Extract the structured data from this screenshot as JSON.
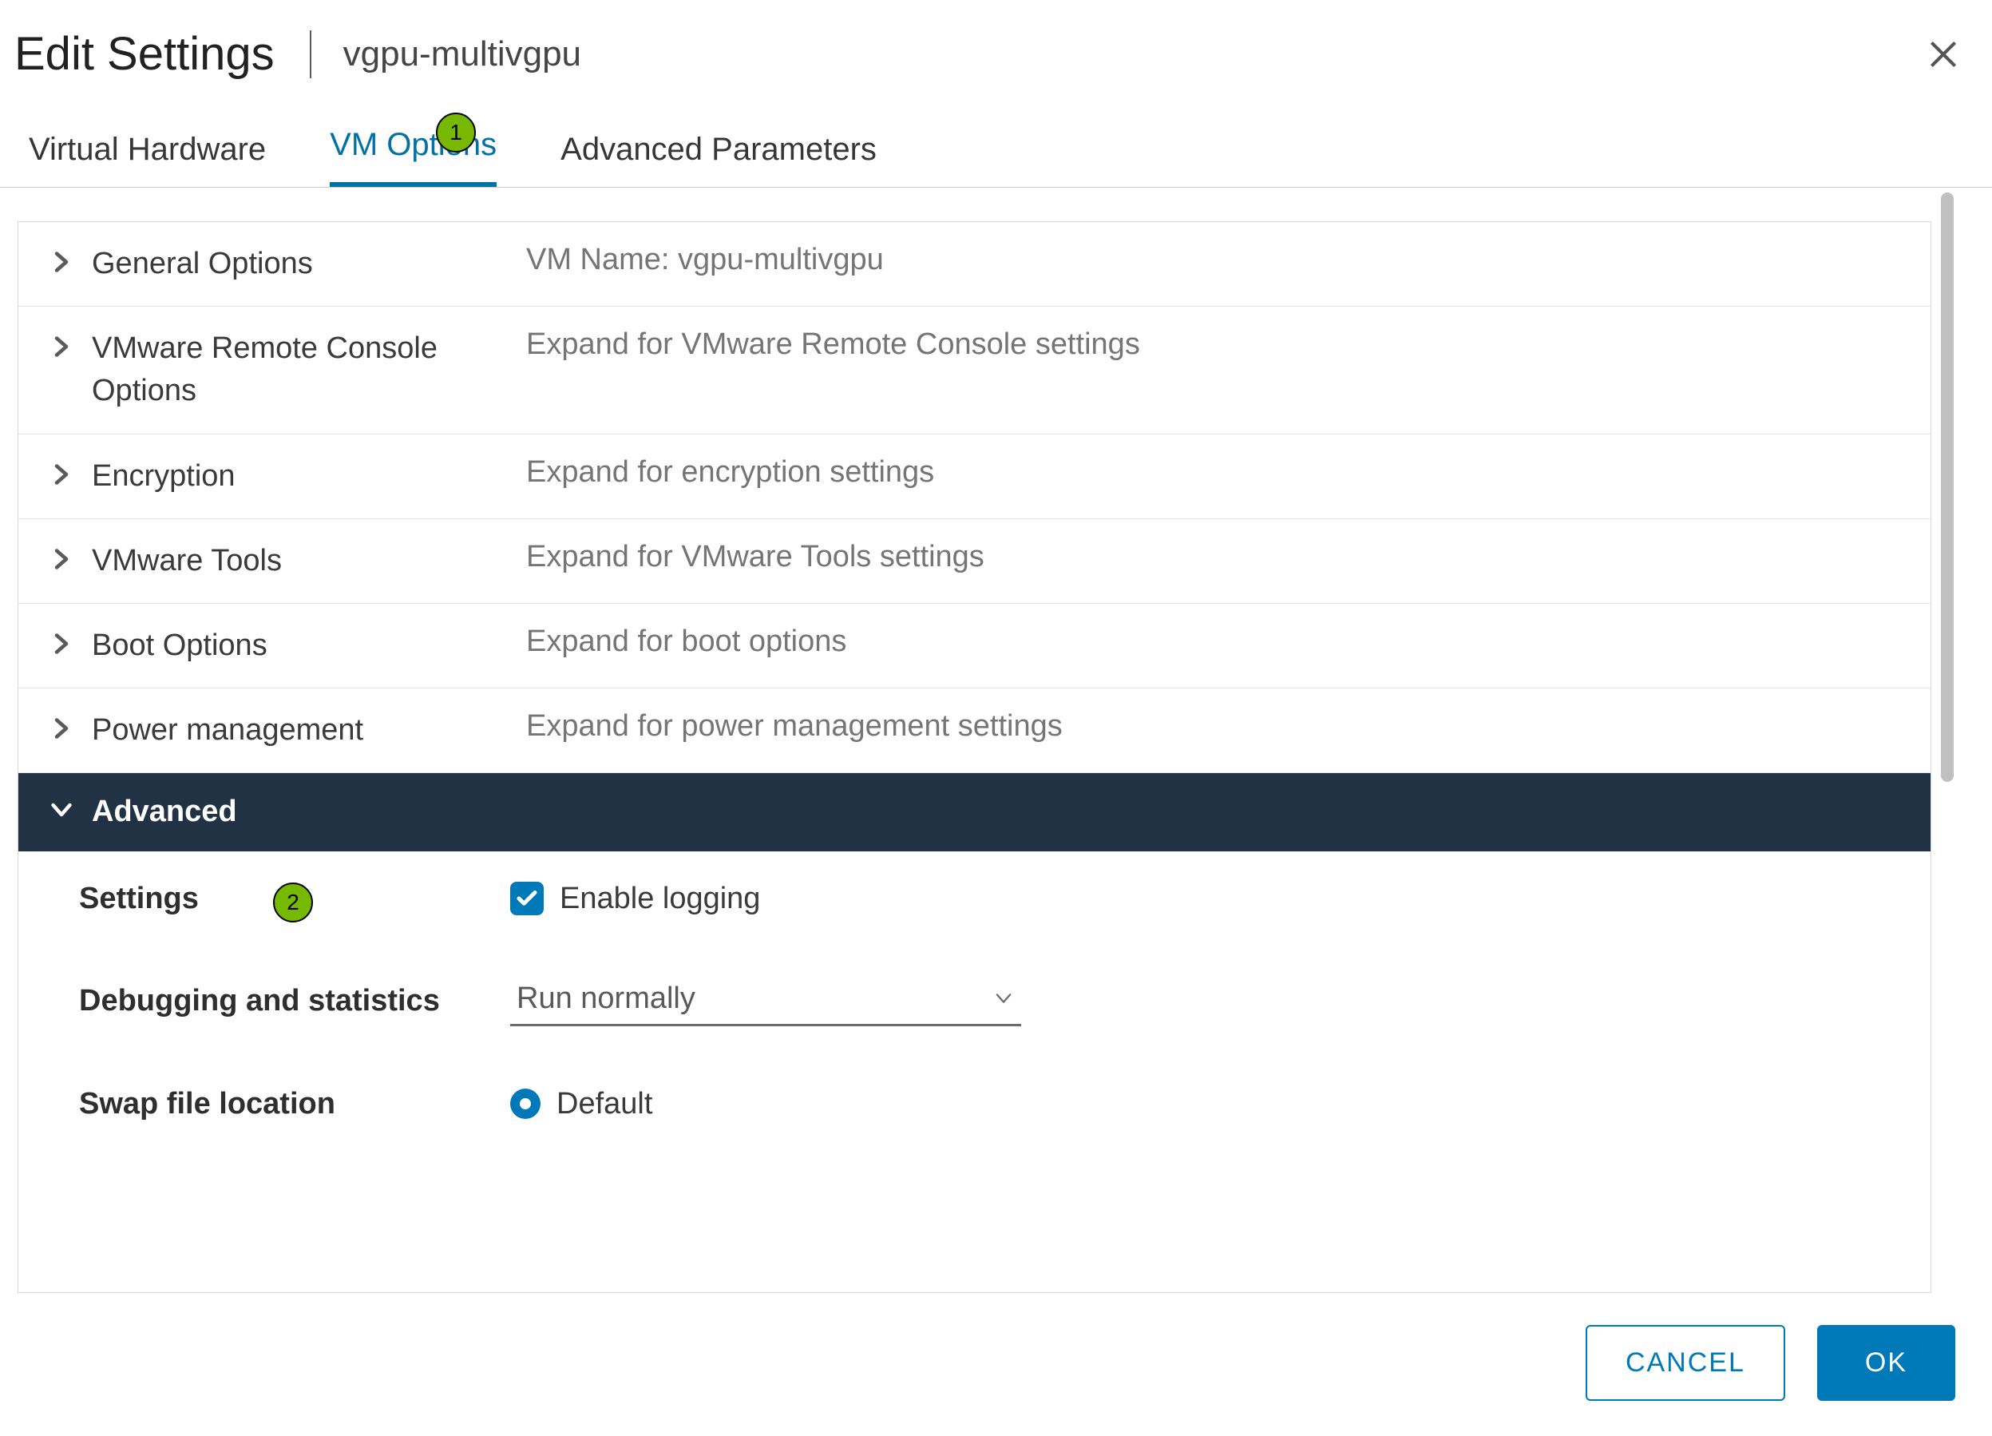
{
  "header": {
    "title": "Edit Settings",
    "subtitle": "vgpu-multivgpu"
  },
  "tabs": {
    "hardware": "Virtual Hardware",
    "options": "VM Options",
    "params": "Advanced Parameters"
  },
  "rows": {
    "general": {
      "label": "General Options",
      "desc": "VM Name: vgpu-multivgpu"
    },
    "remote": {
      "label": "VMware Remote Console Options",
      "desc": "Expand for VMware Remote Console settings"
    },
    "encrypt": {
      "label": "Encryption",
      "desc": "Expand for encryption settings"
    },
    "tools": {
      "label": "VMware Tools",
      "desc": "Expand for VMware Tools settings"
    },
    "boot": {
      "label": "Boot Options",
      "desc": "Expand for boot options"
    },
    "power": {
      "label": "Power management",
      "desc": "Expand for power management settings"
    },
    "advanced": {
      "label": "Advanced"
    }
  },
  "advanced": {
    "settings_label": "Settings",
    "enable_logging": "Enable logging",
    "debug_label": "Debugging and statistics",
    "debug_value": "Run normally",
    "swap_label": "Swap file location",
    "swap_value": "Default"
  },
  "footer": {
    "cancel": "CANCEL",
    "ok": "OK"
  },
  "callouts": {
    "c1": "1",
    "c2": "2"
  }
}
